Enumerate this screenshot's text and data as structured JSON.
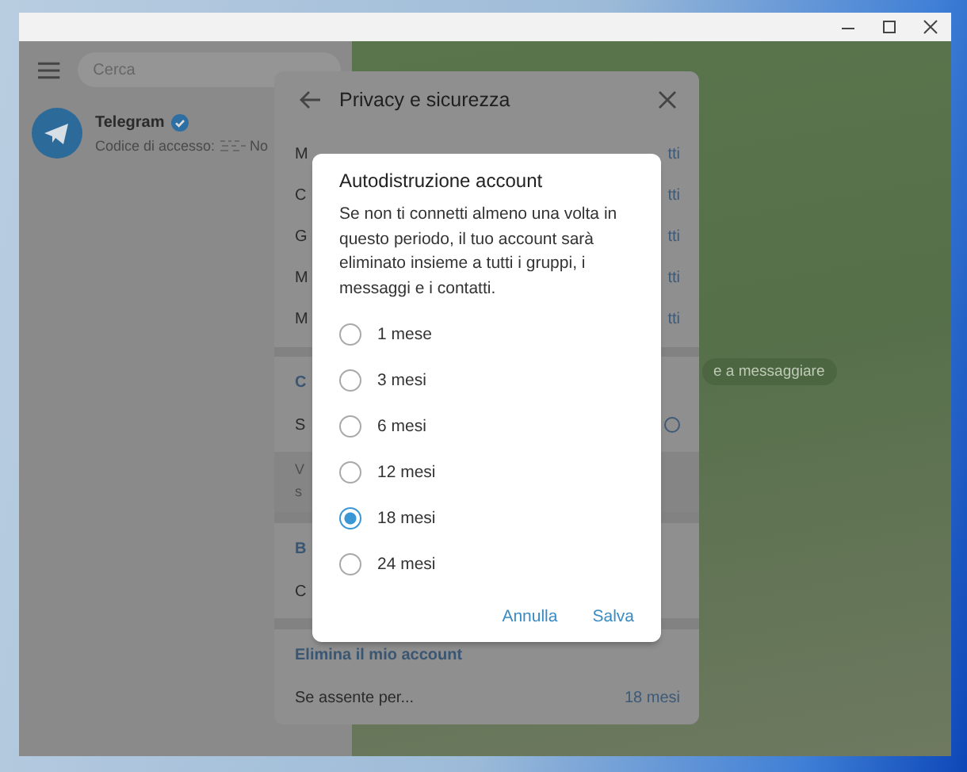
{
  "sidebar": {
    "search": {
      "placeholder": "Cerca"
    },
    "chats": [
      {
        "name": "Telegram",
        "verified": true,
        "preview": "Codice di accesso:",
        "preview_tail": "No"
      }
    ]
  },
  "chat": {
    "notice": "e a messaggiare"
  },
  "settings": {
    "title": "Privacy e sicurezza",
    "sections": [
      {
        "rows": [
          {
            "label": "M",
            "value": "tti"
          },
          {
            "label": "C",
            "value": "tti"
          },
          {
            "label": "G",
            "value": "tti"
          },
          {
            "label": "M",
            "value": "tti"
          },
          {
            "label": "M",
            "value": "tti"
          }
        ]
      },
      {
        "header": "C",
        "rows": [
          {
            "label": "S",
            "kind": "toggle",
            "on": false
          }
        ],
        "note_lines": [
          "V",
          "s"
        ]
      },
      {
        "header": "B",
        "rows": [
          {
            "label": "C"
          }
        ]
      },
      {
        "header": "Elimina il mio account",
        "rows": [
          {
            "label": "Se assente per...",
            "value": "18 mesi"
          }
        ]
      }
    ]
  },
  "dialog": {
    "title": "Autodistruzione account",
    "text": "Se non ti connetti almeno una volta in questo periodo, il tuo account sarà eliminato insieme a tutti i gruppi, i messaggi e i contatti.",
    "options": [
      {
        "label": "1 mese",
        "selected": false
      },
      {
        "label": "3 mesi",
        "selected": false
      },
      {
        "label": "6 mesi",
        "selected": false
      },
      {
        "label": "12 mesi",
        "selected": false
      },
      {
        "label": "18 mesi",
        "selected": true
      },
      {
        "label": "24 mesi",
        "selected": false
      }
    ],
    "buttons": [
      "Annulla",
      "Salva"
    ]
  }
}
